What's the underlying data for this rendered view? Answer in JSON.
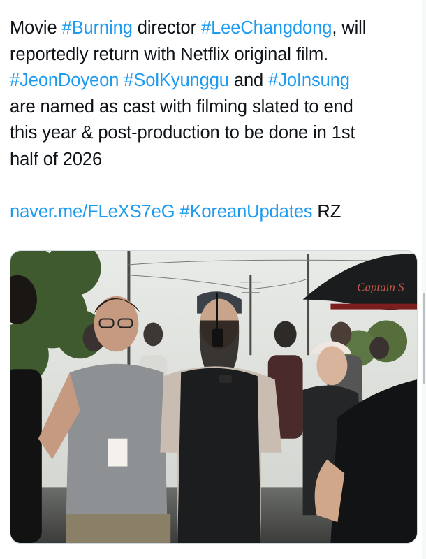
{
  "tweet": {
    "lines": [
      [
        {
          "t": "Movie "
        },
        {
          "t": "#Burning",
          "link": true
        },
        {
          "t": " director "
        },
        {
          "t": "#LeeChangdong",
          "link": true
        },
        {
          "t": ", will"
        }
      ],
      [
        {
          "t": "reportedly return with Netflix original film."
        }
      ],
      [
        {
          "t": "#JeonDoyeon",
          "link": true
        },
        {
          "t": " "
        },
        {
          "t": "#SolKyunggu",
          "link": true
        },
        {
          "t": " and "
        },
        {
          "t": "#JoInsung",
          "link": true
        }
      ],
      [
        {
          "t": "are named as cast with filming slated to end"
        }
      ],
      [
        {
          "t": "this year & post-production to be done in 1st"
        }
      ],
      [
        {
          "t": "half of 2026"
        }
      ],
      [],
      [
        {
          "t": "naver.me/FLeXS7eG",
          "link": true
        },
        {
          "t": " "
        },
        {
          "t": "#KoreanUpdates",
          "link": true
        },
        {
          "t": " RZ"
        }
      ]
    ],
    "link_color": "#1d9bf0",
    "text_color": "#0f1419"
  },
  "media": {
    "umbrella_text": "Captain S",
    "description_icon": "photo"
  }
}
